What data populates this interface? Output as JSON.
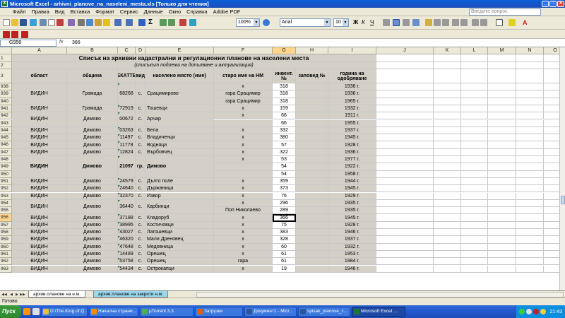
{
  "window": {
    "title": "Microsoft Excel - arhivni_planove_na_naseleni_mesta.xls  [Только для чтения]"
  },
  "menu": [
    "Файл",
    "Правка",
    "Вид",
    "Вставка",
    "Формат",
    "Сервис",
    "Данные",
    "Окно",
    "Справка",
    "Adobe PDF"
  ],
  "help_placeholder": "Введите вопрос",
  "toolbar": {
    "zoom": "100%",
    "font_name": "Arial",
    "font_size": "10"
  },
  "formula_bar": {
    "name_box": "G956",
    "fx": "fx",
    "content": "366"
  },
  "columns": [
    {
      "id": "A",
      "label": "A"
    },
    {
      "id": "B",
      "label": "B"
    },
    {
      "id": "C",
      "label": "C"
    },
    {
      "id": "D",
      "label": "D"
    },
    {
      "id": "E",
      "label": "E"
    },
    {
      "id": "F",
      "label": "F"
    },
    {
      "id": "G",
      "label": "G"
    },
    {
      "id": "H",
      "label": "H"
    },
    {
      "id": "I",
      "label": "I"
    },
    {
      "id": "J",
      "label": "J"
    },
    {
      "id": "K",
      "label": "K"
    },
    {
      "id": "L",
      "label": "L"
    },
    {
      "id": "M",
      "label": "M"
    },
    {
      "id": "N",
      "label": "N"
    },
    {
      "id": "O",
      "label": "O"
    }
  ],
  "sheet": {
    "title_row": {
      "row": "1",
      "text": "Списък на архивни кадастрални и регулационни планове на населени места"
    },
    "subtitle_row": {
      "row": "2",
      "text": "(списъкът подлежи на допълване и актуализация)"
    },
    "header_row": {
      "row": "3",
      "cells": [
        "област",
        "община",
        "ЕКАТТЕ",
        "вид",
        "населено място (име)",
        "старо име на НМ",
        "инвент. №",
        "заповед №",
        "година на одобряване"
      ]
    },
    "rows": [
      {
        "row": "938",
        "merge_start": true,
        "merge_span": 3,
        "a": "ВИДИН",
        "b": "Грамада",
        "c": "68268",
        "d": "с.",
        "e": "Срацимирово",
        "f": "х",
        "g": "318",
        "h": "",
        "i": "1936 г."
      },
      {
        "row": "939",
        "f": "гара Срацимир",
        "g": "318",
        "i": "1936 г."
      },
      {
        "row": "940",
        "f": "гара Срацимир",
        "g": "318",
        "i": "1965 г."
      },
      {
        "row": "941",
        "a": "ВИДИН",
        "b": "Грамада",
        "c": "72919",
        "d": "с.",
        "e": "Тошевци",
        "f": "х",
        "g": "159",
        "i": "1932 г."
      },
      {
        "row": "942",
        "merge_start": true,
        "merge_span": 2,
        "a": "ВИДИН",
        "b": "Димово",
        "c": "00672",
        "d": "с.",
        "e": "Арчар",
        "f": "х",
        "g": "66",
        "i": "1911 г."
      },
      {
        "row": "943",
        "f": "",
        "g": "66",
        "i": "1955 г."
      },
      {
        "row": "944",
        "a": "ВИДИН",
        "b": "Димово",
        "c": "03263",
        "d": "с.",
        "e": "Бела",
        "f": "х",
        "g": "332",
        "i": "1937 г."
      },
      {
        "row": "945",
        "a": "ВИДИН",
        "b": "Димово",
        "c": "11497",
        "d": "с.",
        "e": "Владиченци",
        "f": "х",
        "g": "380",
        "i": "1945 г."
      },
      {
        "row": "946",
        "a": "ВИДИН",
        "b": "Димово",
        "c": "11778",
        "d": "с.",
        "e": "Водняци",
        "f": "х",
        "g": "57",
        "i": "1928 г."
      },
      {
        "row": "947",
        "a": "ВИДИН",
        "b": "Димово",
        "c": "12824",
        "d": "с.",
        "e": "Върбовчец",
        "f": "х",
        "g": "322",
        "i": "1936 г."
      },
      {
        "row": "948",
        "merge_start": true,
        "merge_span": 3,
        "bold": true,
        "a": "ВИДИН",
        "b": "Димово",
        "c": "21097",
        "d": "гр.",
        "e": "Димово",
        "f": "х",
        "g": "53",
        "i": "1977 г."
      },
      {
        "row": "949",
        "f": "",
        "g": "54",
        "i": "1922 г."
      },
      {
        "row": "950",
        "f": "",
        "g": "54",
        "i": "1958 г."
      },
      {
        "row": "951",
        "a": "ВИДИН",
        "b": "Димово",
        "c": "24579",
        "d": "с.",
        "e": "Дълго поле",
        "f": "х",
        "g": "359",
        "i": "1944 г."
      },
      {
        "row": "952",
        "a": "ВИДИН",
        "b": "Димово",
        "c": "24640",
        "d": "с.",
        "e": "Държаница",
        "f": "х",
        "g": "373",
        "i": "1945 г."
      },
      {
        "row": "953",
        "a": "ВИДИН",
        "b": "Димово",
        "c": "32370",
        "d": "с.",
        "e": "Извор",
        "f": "х",
        "g": "76",
        "i": "1929 г."
      },
      {
        "row": "954",
        "merge_start": true,
        "merge_span": 2,
        "a": "ВИДИН",
        "b": "Димово",
        "c": "36440",
        "d": "с.",
        "e": "Карбинци",
        "f": "х",
        "g": "296",
        "i": "1935 г."
      },
      {
        "row": "955",
        "f": "Поп Николаево",
        "g": "289",
        "i": "1935 г."
      },
      {
        "row": "956",
        "a": "ВИДИН",
        "b": "Димово",
        "c": "37188",
        "d": "с.",
        "e": "Кладоруб",
        "f": "х",
        "g": "366",
        "i": "1945 г.",
        "selected": true
      },
      {
        "row": "957",
        "a": "ВИДИН",
        "b": "Димово",
        "c": "38995",
        "d": "с.",
        "e": "Костичовци",
        "f": "х",
        "g": "75",
        "i": "1928 г."
      },
      {
        "row": "958",
        "a": "ВИДИН",
        "b": "Димово",
        "c": "43027",
        "d": "с.",
        "e": "Лагошевци",
        "f": "х",
        "g": "383",
        "i": "1946 г."
      },
      {
        "row": "959",
        "a": "ВИДИН",
        "b": "Димово",
        "c": "46320",
        "d": "с.",
        "e": "Мали Дреновец",
        "f": "х",
        "g": "328",
        "i": "1937 г."
      },
      {
        "row": "960",
        "a": "ВИДИН",
        "b": "Димово",
        "c": "47648",
        "d": "с.",
        "e": "Медовница",
        "f": "х",
        "g": "60",
        "i": "1932 г."
      },
      {
        "row": "961",
        "a": "ВИДИН",
        "b": "Димово",
        "c": "14489",
        "d": "с.",
        "e": "Орешец",
        "f": "х",
        "g": "61",
        "i": "1953 г."
      },
      {
        "row": "962",
        "a": "ВИДИН",
        "b": "Димово",
        "c": "53758",
        "d": "с.",
        "e": "Орешец",
        "f": "гара",
        "g": "61",
        "i": "1984 г."
      },
      {
        "row": "963",
        "a": "ВИДИН",
        "b": "Димово",
        "c": "54434",
        "d": "с.",
        "e": "Острокапци",
        "f": "х",
        "g": "19",
        "i": "1946 г."
      }
    ]
  },
  "sheet_tabs": [
    "архив.планове на н.м.",
    "архив.планове на закрити н.м."
  ],
  "status": "Готово",
  "taskbar": {
    "start": "Пуск",
    "tasks": [
      {
        "label": "D:\\The.King.of.Q...",
        "color": "#e8c040"
      },
      {
        "label": "Начална страни...",
        "color": "#ff8a00"
      },
      {
        "label": "µTorrent 3.3",
        "color": "#4caf50"
      },
      {
        "label": "Загрузки",
        "color": "#e66000"
      },
      {
        "label": "Документ1 - Micr...",
        "color": "#2b5797"
      },
      {
        "label": "spisak_planove_z...",
        "color": "#2b5797"
      },
      {
        "label": "Microsoft Excel ...",
        "color": "#1d7a2c",
        "active": true
      }
    ],
    "clock": "21:43"
  }
}
